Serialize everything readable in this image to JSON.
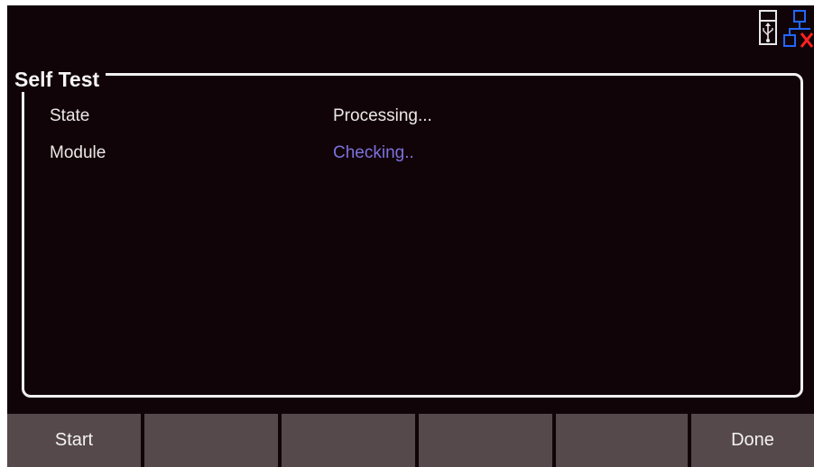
{
  "status_bar": {
    "icons": [
      "usb-storage-icon",
      "network-disconnected-icon"
    ],
    "accent_network": "#2266ff",
    "accent_error": "#ff2222"
  },
  "panel": {
    "title": "Self Test",
    "rows": [
      {
        "label": "State",
        "value": "Processing...",
        "value_color": "#ebe8e8"
      },
      {
        "label": "Module",
        "value": "Checking..",
        "value_color": "#7c72de"
      }
    ]
  },
  "softkeys": {
    "key1": "Start",
    "key2": "",
    "key3": "",
    "key4": "",
    "key5": "",
    "key6": "Done"
  },
  "colors": {
    "background": "#110408",
    "softkey": "#55494b",
    "text": "#ebe8e8",
    "highlight_text": "#7c72de"
  }
}
